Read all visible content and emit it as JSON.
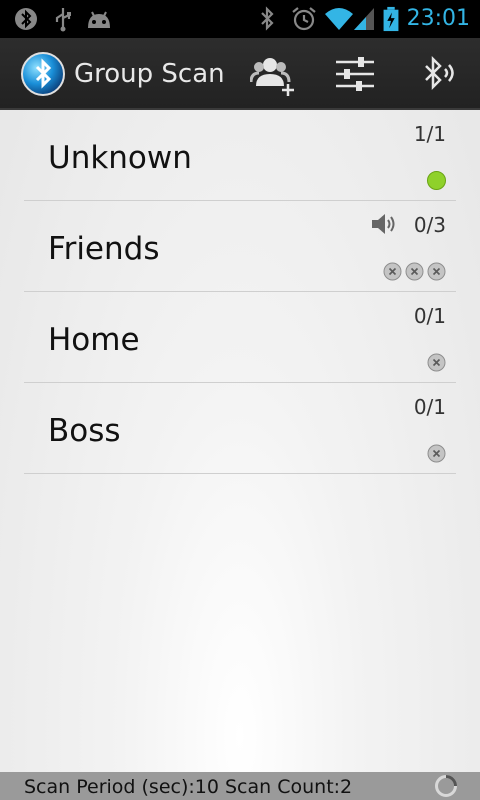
{
  "status_bar": {
    "time": "23:01",
    "left_icons": [
      "bluetooth-notification-icon",
      "usb-icon",
      "android-icon"
    ],
    "right_icons": [
      "bluetooth-icon",
      "alarm-icon",
      "wifi-icon",
      "signal-icon",
      "battery-charging-icon"
    ],
    "accent": "#33b5e5"
  },
  "action_bar": {
    "title": "Group Scan",
    "actions": [
      {
        "icon": "add-group-icon",
        "label": "Add group"
      },
      {
        "icon": "settings-sliders-icon",
        "label": "Settings"
      },
      {
        "icon": "bluetooth-scan-icon",
        "label": "Scan"
      }
    ]
  },
  "groups": [
    {
      "name": "Unknown",
      "count": "1/1",
      "sound": false,
      "devices": [
        "found"
      ]
    },
    {
      "name": "Friends",
      "count": "0/3",
      "sound": true,
      "devices": [
        "missing",
        "missing",
        "missing"
      ]
    },
    {
      "name": "Home",
      "count": "0/1",
      "sound": false,
      "devices": [
        "missing"
      ]
    },
    {
      "name": "Boss",
      "count": "0/1",
      "sound": false,
      "devices": [
        "missing"
      ]
    }
  ],
  "footer": {
    "text": "Scan Period (sec):10 Scan Count:2"
  },
  "colors": {
    "found": "#8fd12a",
    "missing": "#b3b3b3"
  }
}
